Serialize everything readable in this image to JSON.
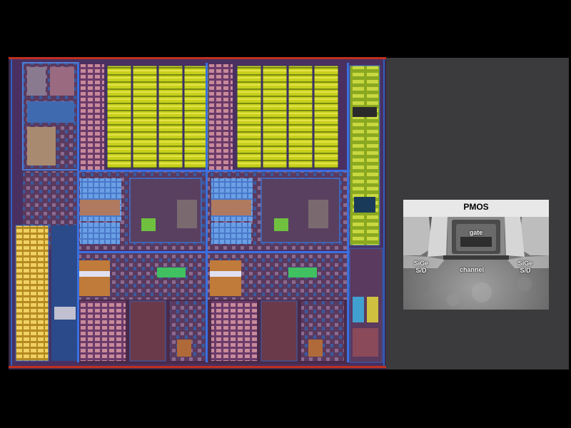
{
  "image": {
    "description_colors": {
      "background": "#000000",
      "panel": "#3b3a3c"
    }
  },
  "micrograph": {
    "title": "PMOS",
    "gate_label": "gate",
    "left_sd_line1": "SiGe",
    "left_sd_line2": "S/D",
    "channel_label": "channel",
    "right_sd_line1": "SiGe",
    "right_sd_line2": "S/D"
  }
}
